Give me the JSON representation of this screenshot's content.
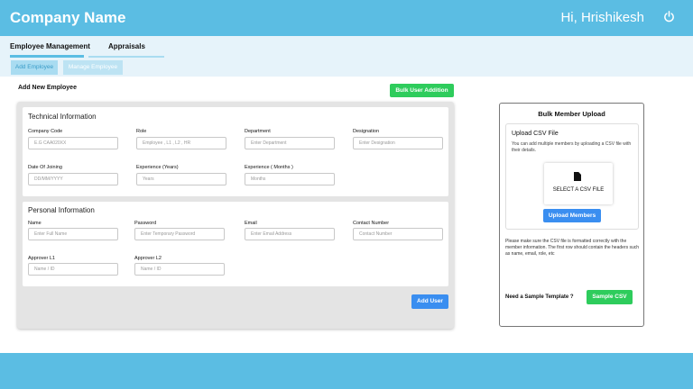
{
  "header": {
    "brand": "Company Name",
    "greeting": "Hi, Hrishikesh",
    "power_icon": "power-icon"
  },
  "tabs": [
    {
      "label": "Employee Management",
      "active": true
    },
    {
      "label": "Appraisals",
      "active": false
    }
  ],
  "subtabs": [
    {
      "label": "Add Employee",
      "active": true
    },
    {
      "label": "Manage Employee",
      "active": false
    }
  ],
  "page": {
    "title": "Add New Employee",
    "bulk_button": "Bulk User Addition",
    "add_user_button": "Add User"
  },
  "technical": {
    "title": "Technical Information",
    "fields": [
      {
        "label": "Company Code",
        "placeholder": "E.G CAA020XX"
      },
      {
        "label": "Role",
        "placeholder": "Employee , L1 , L2 , HR"
      },
      {
        "label": "Department",
        "placeholder": "Enter Department"
      },
      {
        "label": "Designation",
        "placeholder": "Enter Designation"
      },
      {
        "label": "Date Of Joining",
        "placeholder": "DD/MM/YYYY"
      },
      {
        "label": "Experience (Years)",
        "placeholder": "Years"
      },
      {
        "label": "Experience ( Months )",
        "placeholder": "Months"
      }
    ]
  },
  "personal": {
    "title": "Personal Information",
    "fields": [
      {
        "label": "Name",
        "placeholder": "Enter Full Name"
      },
      {
        "label": "Password",
        "placeholder": "Enter Temporary Password"
      },
      {
        "label": "Email",
        "placeholder": "Enter Email Address"
      },
      {
        "label": "Contact Number",
        "placeholder": "Contact Number"
      },
      {
        "label": "Approver L1",
        "placeholder": "Name / ID"
      },
      {
        "label": "Approver L2",
        "placeholder": "Name / ID"
      }
    ]
  },
  "bulk": {
    "title": "Bulk Member Upload",
    "upload_title": "Upload CSV File",
    "upload_desc": "You can add multiple members by uploading a CSV file with their details.",
    "select_label": "SELECT A CSV FILE",
    "file_icon": "file-icon",
    "upload_button": "Upload Members",
    "note": "Please make sure the CSV file is formatted correctly with the member information. The first row should contain the headers such as name, email, role, etc",
    "sample_question": "Need a Sample Template ?",
    "sample_button": "Sample CSV"
  },
  "colors": {
    "primary": "#5bbde3",
    "green": "#2ecc5c",
    "blue": "#3a8ef0"
  }
}
